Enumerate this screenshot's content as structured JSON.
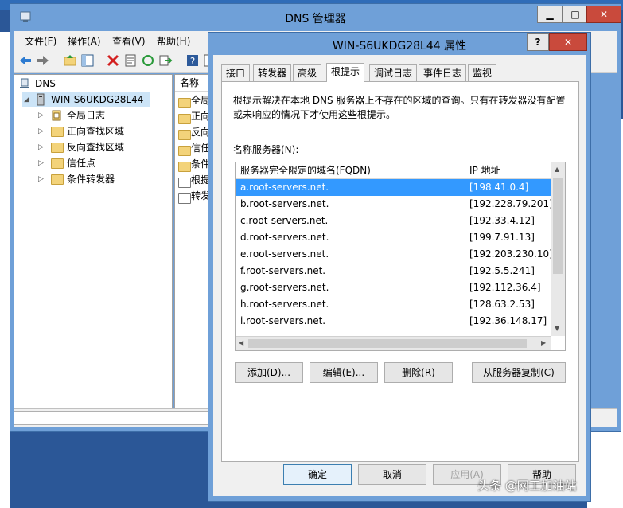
{
  "main_window": {
    "title": "DNS 管理器",
    "menu": [
      "文件(F)",
      "操作(A)",
      "查看(V)",
      "帮助(H)"
    ],
    "tree": {
      "root": "DNS",
      "server": "WIN-S6UKDG28L44",
      "children": [
        "全局日志",
        "正向查找区域",
        "反向查找区域",
        "信任点",
        "条件转发器"
      ]
    },
    "list": {
      "header": "名称",
      "items": [
        "全局",
        "正向",
        "反向",
        "信任",
        "条件",
        "根提",
        "转发"
      ]
    }
  },
  "dialog": {
    "title": "WIN-S6UKDG28L44 属性",
    "help": "?",
    "close": "✕",
    "tabs": [
      "接口",
      "转发器",
      "高级",
      "根提示",
      "调试日志",
      "事件日志",
      "监视"
    ],
    "active_tab": "根提示",
    "description": "根提示解决在本地 DNS 服务器上不存在的区域的查询。只有在转发器没有配置或未响应的情况下才使用这些根提示。",
    "ns_label": "名称服务器(N):",
    "columns": [
      "服务器完全限定的域名(FQDN)",
      "IP 地址"
    ],
    "rows": [
      {
        "name": "a.root-servers.net.",
        "ip": "[198.41.0.4]",
        "selected": true
      },
      {
        "name": "b.root-servers.net.",
        "ip": "[192.228.79.201]"
      },
      {
        "name": "c.root-servers.net.",
        "ip": "[192.33.4.12]"
      },
      {
        "name": "d.root-servers.net.",
        "ip": "[199.7.91.13]"
      },
      {
        "name": "e.root-servers.net.",
        "ip": "[192.203.230.10]"
      },
      {
        "name": "f.root-servers.net.",
        "ip": "[192.5.5.241]"
      },
      {
        "name": "g.root-servers.net.",
        "ip": "[192.112.36.4]"
      },
      {
        "name": "h.root-servers.net.",
        "ip": "[128.63.2.53]"
      },
      {
        "name": "i.root-servers.net.",
        "ip": "[192.36.148.17]"
      }
    ],
    "buttons": {
      "add": "添加(D)...",
      "edit": "编辑(E)...",
      "delete": "删除(R)",
      "copy": "从服务器复制(C)"
    },
    "footer": {
      "ok": "确定",
      "cancel": "取消",
      "apply": "应用(A)",
      "help": "帮助"
    }
  },
  "watermark": "头条 @网工加油站",
  "colors": {
    "selection": "#3399ff",
    "titlebar": "#6fa0d8",
    "close": "#c94a3c"
  }
}
